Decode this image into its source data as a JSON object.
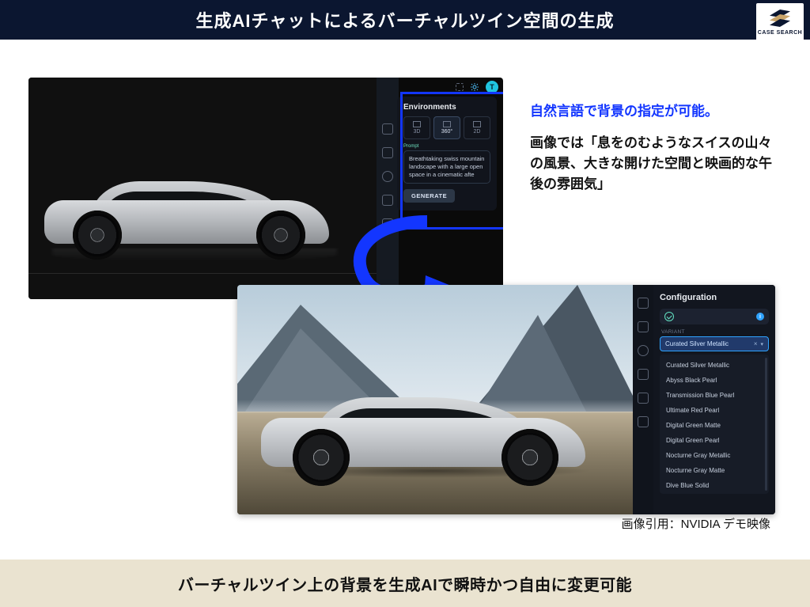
{
  "header": {
    "title": "生成AIチャットによるバーチャルツイン空間の生成",
    "logo_text": "CASE SEARCH"
  },
  "shot1": {
    "topright": {
      "avatar_letter": "T"
    },
    "environments": {
      "panel_title": "Environments",
      "tabs": {
        "3d": "3D",
        "360": "360°",
        "2d": "2D"
      },
      "prompt_label": "Prompt",
      "prompt_value": "Breathtaking swiss mountain landscape with a large open space in a cinematic afte",
      "generate_label": "GENERATE"
    }
  },
  "explain": {
    "lead": "自然言語で背景の指定が可能。",
    "body": "画像では「息をのむようなスイスの山々の風景、大きな開けた空間と映画的な午後の雰囲気」"
  },
  "shot2": {
    "configuration": {
      "panel_title": "Configuration",
      "info_badge": "i",
      "variant_label": "VARIANT",
      "selected": "Curated Silver Metallic",
      "options": [
        "Curated Silver Metallic",
        "Abyss Black Pearl",
        "Transmission Blue Pearl",
        "Ultimate Red Pearl",
        "Digital Green Matte",
        "Digital Green Pearl",
        "Nocturne Gray Metallic",
        "Nocturne Gray Matte",
        "Dive Blue Solid"
      ]
    }
  },
  "citation": "画像引用：NVIDIA デモ映像",
  "footer": "バーチャルツイン上の背景を生成AIで瞬時かつ自由に変更可能"
}
